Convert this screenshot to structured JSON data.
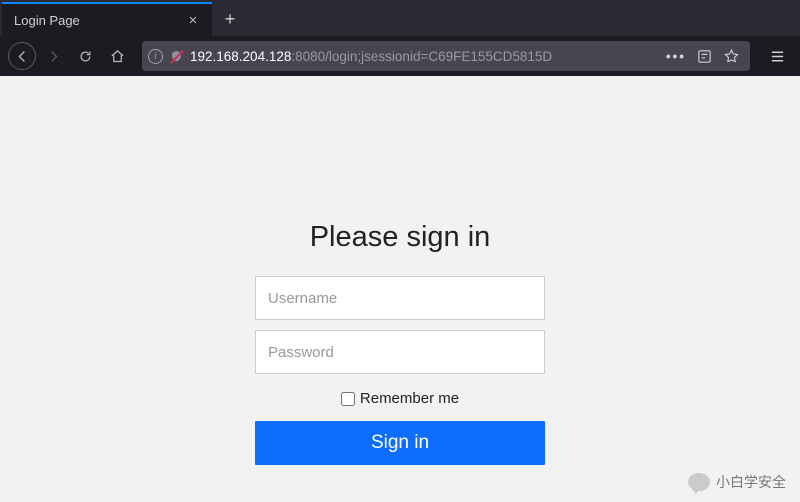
{
  "browser": {
    "tab_title": "Login Page",
    "url_host": "192.168.204.128",
    "url_port_path": ":8080/login;jsessionid=C69FE155CD5815D"
  },
  "form": {
    "heading": "Please sign in",
    "username_placeholder": "Username",
    "password_placeholder": "Password",
    "remember_label": "Remember me",
    "submit_label": "Sign in"
  },
  "watermark": {
    "text": "小白学安全"
  },
  "colors": {
    "accent": "#0d6efd",
    "chrome_bg": "#2b2a33"
  }
}
